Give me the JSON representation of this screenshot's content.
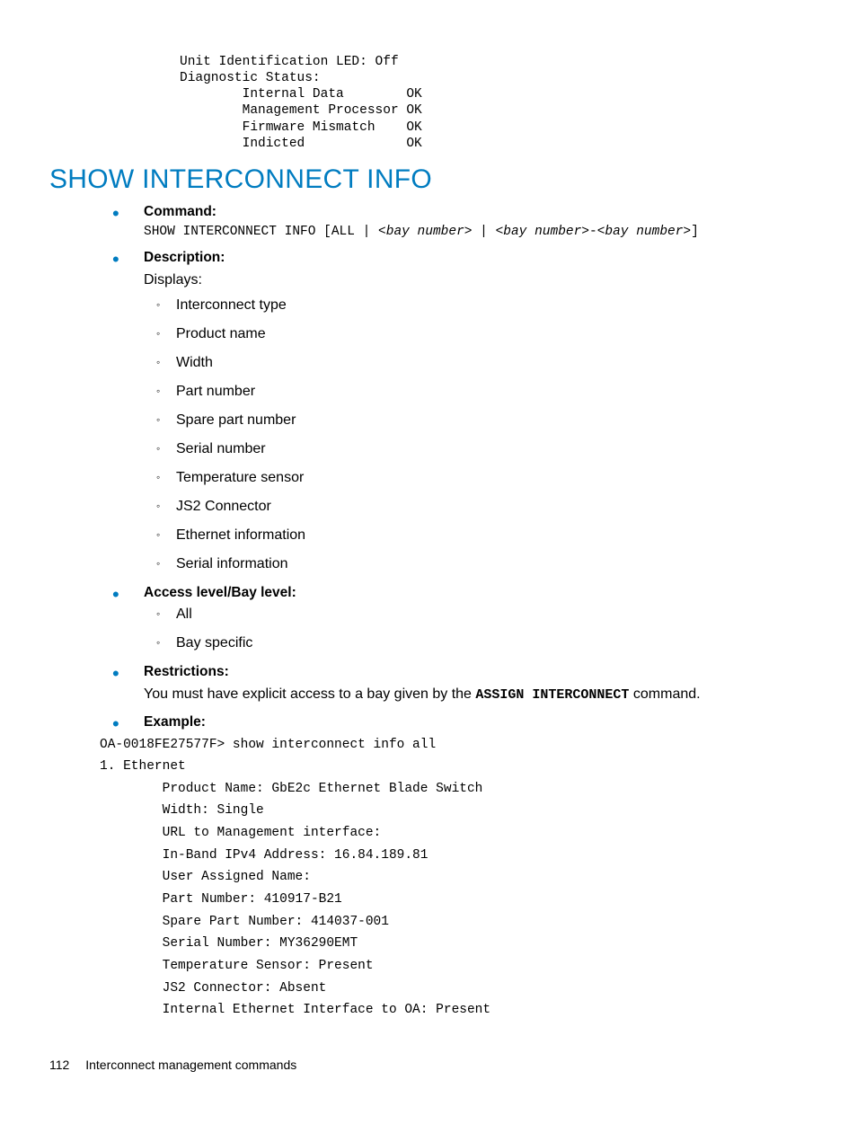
{
  "top_block": "Unit Identification LED: Off\nDiagnostic Status:\n        Internal Data        OK\n        Management Processor OK\n        Firmware Mismatch    OK\n        Indicted             OK",
  "heading": "SHOW INTERCONNECT INFO",
  "command": {
    "label": "Command:",
    "prefix": "SHOW INTERCONNECT INFO [ALL | <",
    "bay1": "bay number",
    "mid1": "> | <",
    "bay2": "bay number",
    "mid2": ">-<",
    "bay3": "bay number",
    "suffix": ">]"
  },
  "description": {
    "label": "Description:",
    "intro": "Displays:",
    "items": [
      "Interconnect type",
      "Product name",
      "Width",
      "Part number",
      "Spare part number",
      "Serial number",
      "Temperature sensor",
      "JS2 Connector",
      "Ethernet information",
      "Serial information"
    ]
  },
  "access": {
    "label": "Access level/Bay level:",
    "items": [
      "All",
      "Bay specific"
    ]
  },
  "restrictions": {
    "label": "Restrictions:",
    "pre": "You must have explicit access to a bay given by the ",
    "cmd": "ASSIGN INTERCONNECT",
    "post": " command."
  },
  "example": {
    "label": "Example:",
    "text": "OA-0018FE27577F> show interconnect info all\n1. Ethernet\n        Product Name: GbE2c Ethernet Blade Switch\n        Width: Single\n        URL to Management interface:\n        In-Band IPv4 Address: 16.84.189.81\n        User Assigned Name:\n        Part Number: 410917-B21\n        Spare Part Number: 414037-001\n        Serial Number: MY36290EMT\n        Temperature Sensor: Present\n        JS2 Connector: Absent\n        Internal Ethernet Interface to OA: Present"
  },
  "footer": {
    "page": "112",
    "title": "Interconnect management commands"
  }
}
